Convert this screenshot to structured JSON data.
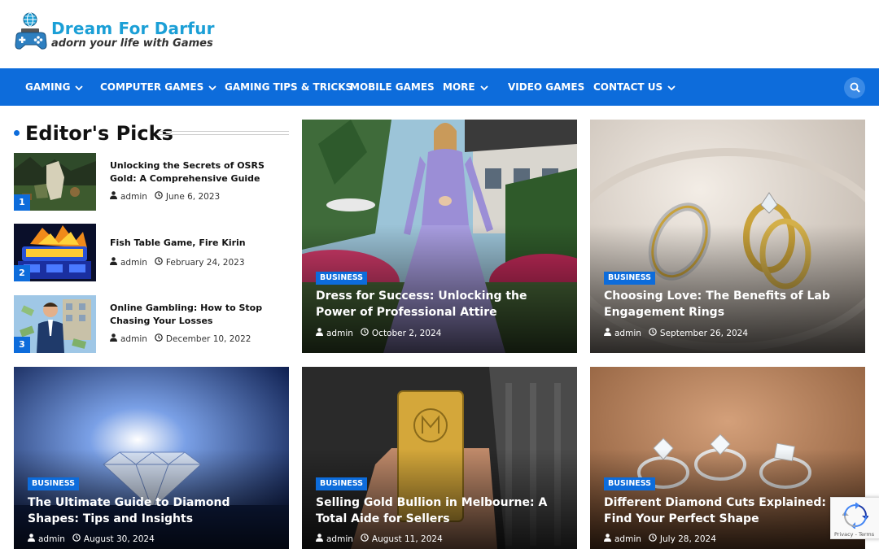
{
  "site": {
    "title": "Dream For Darfur",
    "tagline": "adorn your life with Games"
  },
  "nav": {
    "items": [
      {
        "label": "GAMING",
        "has_dropdown": true
      },
      {
        "label": "COMPUTER GAMES",
        "has_dropdown": true
      },
      {
        "label": "GAMING TIPS & TRICKS",
        "has_dropdown": false
      },
      {
        "label": "MOBILE GAMES",
        "has_dropdown": false
      },
      {
        "label": "MORE",
        "has_dropdown": true
      },
      {
        "label": "VIDEO GAMES",
        "has_dropdown": false
      },
      {
        "label": "CONTACT US",
        "has_dropdown": true
      }
    ],
    "search_icon": "search-icon"
  },
  "editors_picks": {
    "heading": "Editor's Picks",
    "items": [
      {
        "number": "1",
        "title": "Unlocking the Secrets of OSRS Gold: A Comprehensive Guide",
        "author": "admin",
        "date": "June 6, 2023"
      },
      {
        "number": "2",
        "title": "Fish Table Game, Fire Kirin",
        "author": "admin",
        "date": "February 24, 2023"
      },
      {
        "number": "3",
        "title": "Online Gambling: How to Stop Chasing Your Losses",
        "author": "admin",
        "date": "December 10, 2022"
      }
    ]
  },
  "cards": [
    {
      "category": "BUSINESS",
      "title": "Dress for Success: Unlocking the Power of Professional Attire",
      "author": "admin",
      "date": "October 2, 2024"
    },
    {
      "category": "BUSINESS",
      "title": "Choosing Love: The Benefits of Lab Engagement Rings",
      "author": "admin",
      "date": "September 26, 2024"
    },
    {
      "category": "BUSINESS",
      "title": "The Ultimate Guide to Diamond Shapes: Tips and Insights",
      "author": "admin",
      "date": "August 30, 2024"
    },
    {
      "category": "BUSINESS",
      "title": "Selling Gold Bullion in Melbourne: A Total Aide for Sellers",
      "author": "admin",
      "date": "August 11, 2024"
    },
    {
      "category": "BUSINESS",
      "title": "Different Diamond Cuts Explained: Find Your Perfect Shape",
      "author": "admin",
      "date": "July 28, 2024"
    }
  ],
  "recaptcha": {
    "links": "Privacy - Terms"
  },
  "colors": {
    "brand_blue": "#0d6cdb",
    "logo_blue": "#1b9fd6"
  }
}
